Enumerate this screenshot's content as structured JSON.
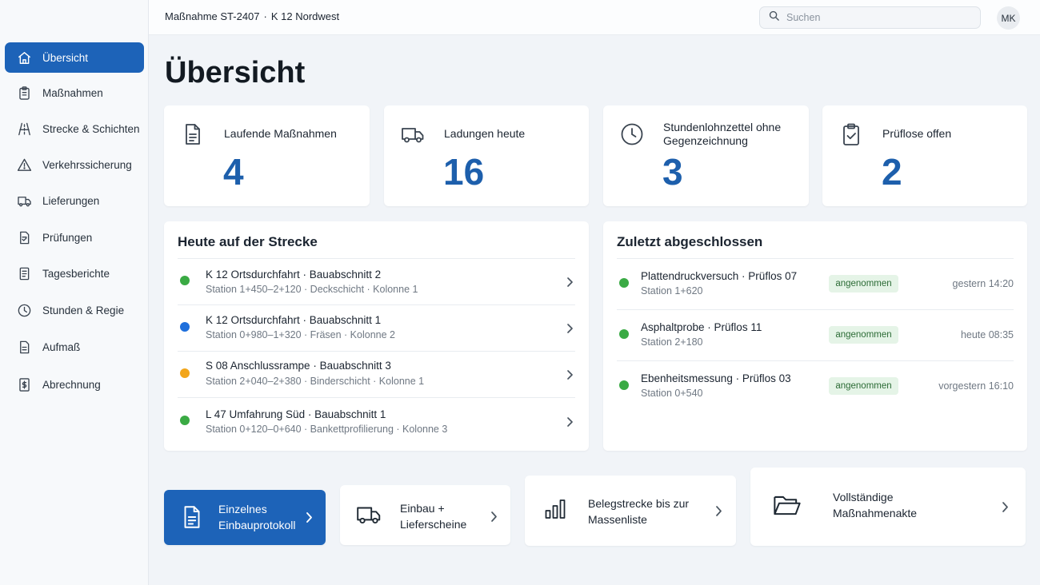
{
  "colors": {
    "accent": "#1d63b8",
    "stat_value": "#1d5fac",
    "status_green": "#3aaa44",
    "status_blue": "#1e6fdc",
    "status_orange": "#f2a51a",
    "badge_bg": "#e5f4e7",
    "badge_text": "#2b6b35"
  },
  "header": {
    "breadcrumb_measure": "Maßnahme ST-2407",
    "breadcrumb_separator": "·",
    "breadcrumb_road": "K 12 Nordwest",
    "search_placeholder": "Suchen",
    "search_icon": "search-icon",
    "avatar_initials": "MK"
  },
  "sidebar": {
    "items": [
      {
        "label": "Übersicht",
        "icon": "home-icon",
        "active": true
      },
      {
        "label": "Maßnahmen",
        "icon": "clipboard-icon",
        "active": false
      },
      {
        "label": "Strecke & Schichten",
        "icon": "road-icon",
        "active": false
      },
      {
        "label": "Verkehrssicherung",
        "icon": "warning-icon",
        "active": false
      },
      {
        "label": "Lieferungen",
        "icon": "truck-icon",
        "active": false
      },
      {
        "label": "Prüfungen",
        "icon": "test-doc-icon",
        "active": false
      },
      {
        "label": "Tagesberichte",
        "icon": "report-icon",
        "active": false
      },
      {
        "label": "Stunden & Regie",
        "icon": "clock-icon",
        "active": false
      },
      {
        "label": "Aufmaß",
        "icon": "measure-doc-icon",
        "active": false
      },
      {
        "label": "Abrechnung",
        "icon": "invoice-icon",
        "active": false
      }
    ]
  },
  "page": {
    "title": "Übersicht"
  },
  "stats": [
    {
      "label": "Laufende Maßnahmen",
      "value": "4",
      "icon": "document-icon"
    },
    {
      "label": "Ladungen heute",
      "value": "16",
      "icon": "truck-icon"
    },
    {
      "label": "Stundenlohnzettel ohne Gegenzeichnung",
      "value": "3",
      "icon": "clock-icon"
    },
    {
      "label": "Prüflose offen",
      "value": "2",
      "icon": "clipboard-check-icon"
    }
  ],
  "today": {
    "title": "Heute auf der Strecke",
    "rows": [
      {
        "title": "K 12 Ortsdurchfahrt · Bauabschnitt 2",
        "subtitle": "Station 1+450–2+120 · Deckschicht · Kolonne 1",
        "status": "green"
      },
      {
        "title": "K 12 Ortsdurchfahrt · Bauabschnitt 1",
        "subtitle": "Station 0+980–1+320 · Fräsen · Kolonne 2",
        "status": "blue"
      },
      {
        "title": "S 08 Anschlussrampe · Bauabschnitt 3",
        "subtitle": "Station 2+040–2+380 · Binderschicht · Kolonne 1",
        "status": "orange"
      },
      {
        "title": "L 47 Umfahrung Süd · Bauabschnitt 1",
        "subtitle": "Station 0+120–0+640 · Bankettprofilierung · Kolonne 3",
        "status": "green"
      }
    ]
  },
  "completed": {
    "title": "Zuletzt abgeschlossen",
    "rows": [
      {
        "title": "Plattendruckversuch · Prüflos 07",
        "subtitle": "Station 1+620",
        "badge": "angenommen",
        "time": "gestern 14:20"
      },
      {
        "title": "Asphaltprobe · Prüflos 11",
        "subtitle": "Station 2+180",
        "badge": "angenommen",
        "time": "heute 08:35"
      },
      {
        "title": "Ebenheitsmessung · Prüflos 03",
        "subtitle": "Station 0+540",
        "badge": "angenommen",
        "time": "vorgestern 16:10"
      }
    ]
  },
  "actions": [
    {
      "line1": "Einzelnes",
      "line2": "Einbauprotokoll",
      "icon": "document-icon",
      "primary": true
    },
    {
      "line1": "Einbau +",
      "line2": "Lieferscheine",
      "icon": "truck-icon",
      "primary": false
    },
    {
      "line1": "Belegstrecke bis zur",
      "line2": "Massenliste",
      "icon": "bar-chart-icon",
      "primary": false
    },
    {
      "line1": "Vollständige",
      "line2": "Maßnahmenakte",
      "icon": "folder-icon",
      "primary": false
    }
  ]
}
